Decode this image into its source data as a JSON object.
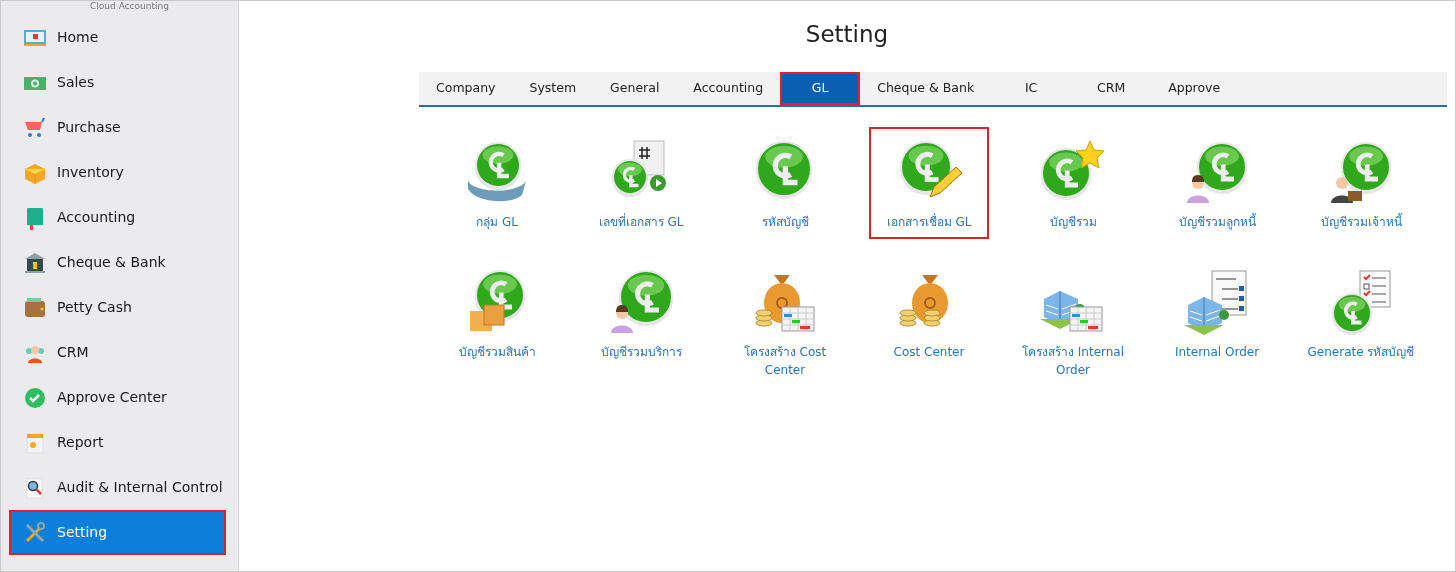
{
  "sidebar": {
    "caption": "Cloud Accounting",
    "items": [
      {
        "label": "Home",
        "selected": false,
        "highlighted": false
      },
      {
        "label": "Sales",
        "selected": false,
        "highlighted": false
      },
      {
        "label": "Purchase",
        "selected": false,
        "highlighted": false
      },
      {
        "label": "Inventory",
        "selected": false,
        "highlighted": false
      },
      {
        "label": "Accounting",
        "selected": false,
        "highlighted": false
      },
      {
        "label": "Cheque & Bank",
        "selected": false,
        "highlighted": false
      },
      {
        "label": "Petty Cash",
        "selected": false,
        "highlighted": false
      },
      {
        "label": "CRM",
        "selected": false,
        "highlighted": false
      },
      {
        "label": "Approve Center",
        "selected": false,
        "highlighted": false
      },
      {
        "label": "Report",
        "selected": false,
        "highlighted": false
      },
      {
        "label": "Audit & Internal Control",
        "selected": false,
        "highlighted": false
      },
      {
        "label": "Setting",
        "selected": true,
        "highlighted": true
      }
    ]
  },
  "page": {
    "title": "Setting"
  },
  "tabs": [
    {
      "label": "Company",
      "selected": false,
      "highlighted": false
    },
    {
      "label": "System",
      "selected": false,
      "highlighted": false
    },
    {
      "label": "General",
      "selected": false,
      "highlighted": false
    },
    {
      "label": "Accounting",
      "selected": false,
      "highlighted": false
    },
    {
      "label": "GL",
      "selected": true,
      "highlighted": true
    },
    {
      "label": "Cheque & Bank",
      "selected": false,
      "highlighted": false
    },
    {
      "label": "IC",
      "selected": false,
      "highlighted": false
    },
    {
      "label": "CRM",
      "selected": false,
      "highlighted": false
    },
    {
      "label": "Approve",
      "selected": false,
      "highlighted": false
    }
  ],
  "tiles": [
    {
      "label": "กลุ่ม GL",
      "highlighted": false
    },
    {
      "label": "เลขที่เอกสาร GL",
      "highlighted": false
    },
    {
      "label": "รหัสบัญชี",
      "highlighted": false
    },
    {
      "label": "เอกสารเชื่อม GL",
      "highlighted": true
    },
    {
      "label": "บัญชีรวม",
      "highlighted": false
    },
    {
      "label": "บัญชีรวมลูกหนี้",
      "highlighted": false
    },
    {
      "label": "บัญชีรวมเจ้าหนี้",
      "highlighted": false
    },
    {
      "label": "บัญชีรวมสินค้า",
      "highlighted": false
    },
    {
      "label": "บัญชีรวมบริการ",
      "highlighted": false
    },
    {
      "label": "โครงสร้าง Cost Center",
      "highlighted": false
    },
    {
      "label": "Cost Center",
      "highlighted": false
    },
    {
      "label": "โครงสร้าง Internal Order",
      "highlighted": false
    },
    {
      "label": "Internal Order",
      "highlighted": false
    },
    {
      "label": "Generate รหัสบัญชี",
      "highlighted": false
    }
  ]
}
